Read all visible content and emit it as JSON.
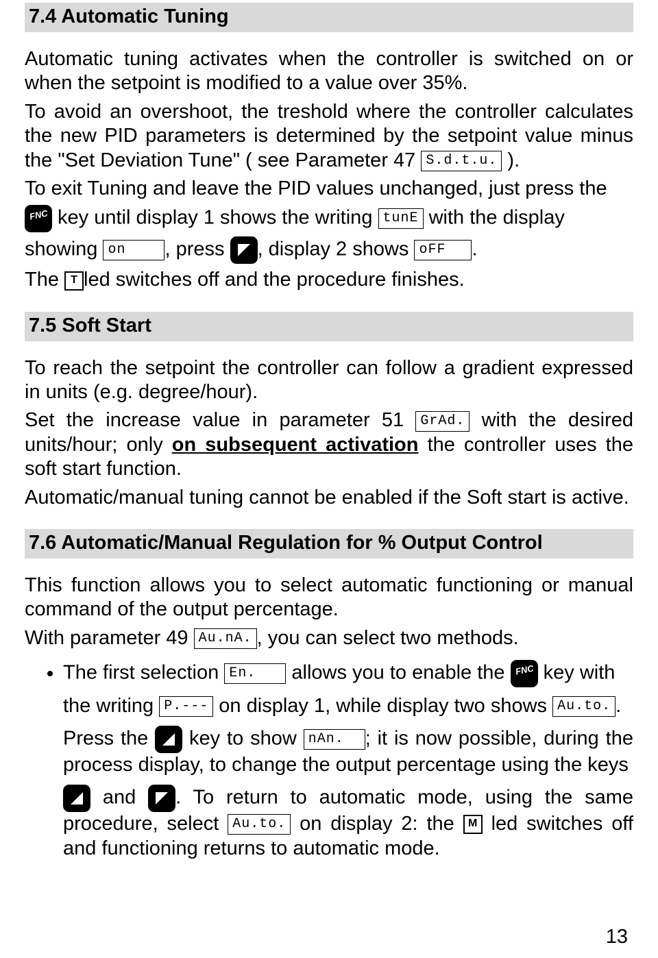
{
  "section74": {
    "heading": "7.4   Automatic Tuning",
    "p1": "Automatic tuning activates when the controller is switched on or when the setpoint is modified to a value over 35%.",
    "p2a": "To avoid an overshoot, the treshold where the controller calculates the new PID parameters is determined by the setpoint value minus the \"Set Deviation Tune\" ( see Parameter 47 ",
    "p2b": " ).",
    "p3a": "To exit Tuning and leave the PID values unchanged, just press the",
    "p3b": " key until display 1 shows the writing ",
    "p3c": " with the display",
    "p4a": "showing ",
    "p4b": ", press  ",
    "p4c": ", display 2 shows ",
    "p4d": ".",
    "p5a": "The ",
    "p5b": "led switches off and the procedure finishes.",
    "glyph_sdtu": "S.d.t.u.",
    "glyph_tune": "tunE",
    "glyph_on": "on",
    "glyph_off": "oFF",
    "tled": "T"
  },
  "section75": {
    "heading": "7.5   Soft Start",
    "p1": "To reach the setpoint the controller can follow a gradient expressed in units (e.g. degree/hour).",
    "p2a": "Set the increase value in parameter 51 ",
    "p2b": " with the desired units/hour; only ",
    "p2c": "on subsequent activation",
    "p2d": " the controller uses the soft start function.",
    "p3": "Automatic/manual tuning cannot be enabled if the Soft start is active.",
    "glyph_grad": "GrAd."
  },
  "section76": {
    "heading": "7.6   Automatic/Manual Regulation for % Output Control",
    "p1": "This function allows you to select automatic functioning or manual command of the output percentage.",
    "p2a": "With parameter 49 ",
    "p2b": ", you can select two methods.",
    "b1a": "The first selection ",
    "b1b": " allows you to enable the ",
    "b1c": " key with",
    "b2a": "the writing ",
    "b2b": " on display 1, while display two shows ",
    "b2c": ".",
    "b3a": "Press the ",
    "b3b": " key to show ",
    "b3c": "; it is now possible, during the process display, to change the output percentage using the keys",
    "b4a": " and ",
    "b4b": ". To return to automatic mode, using the same procedure, select ",
    "b4c": " on display 2: the ",
    "b4d": " led switches off and functioning returns to automatic mode.",
    "glyph_auna": "Au.nA.",
    "glyph_en": "En.",
    "glyph_pdash": "P.---",
    "glyph_auto": "Au.to.",
    "glyph_nan": "nAn.",
    "mled": "M"
  },
  "page": "13"
}
